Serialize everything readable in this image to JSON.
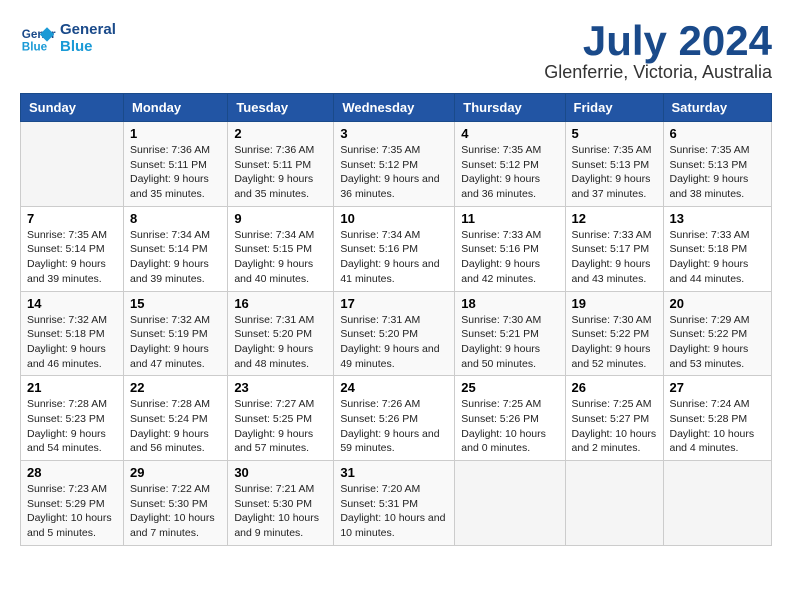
{
  "logo": {
    "line1": "General",
    "line2": "Blue"
  },
  "title": "July 2024",
  "location": "Glenferrie, Victoria, Australia",
  "headers": [
    "Sunday",
    "Monday",
    "Tuesday",
    "Wednesday",
    "Thursday",
    "Friday",
    "Saturday"
  ],
  "weeks": [
    [
      {
        "day": "",
        "sunrise": "",
        "sunset": "",
        "daylight": ""
      },
      {
        "day": "1",
        "sunrise": "Sunrise: 7:36 AM",
        "sunset": "Sunset: 5:11 PM",
        "daylight": "Daylight: 9 hours and 35 minutes."
      },
      {
        "day": "2",
        "sunrise": "Sunrise: 7:36 AM",
        "sunset": "Sunset: 5:11 PM",
        "daylight": "Daylight: 9 hours and 35 minutes."
      },
      {
        "day": "3",
        "sunrise": "Sunrise: 7:35 AM",
        "sunset": "Sunset: 5:12 PM",
        "daylight": "Daylight: 9 hours and 36 minutes."
      },
      {
        "day": "4",
        "sunrise": "Sunrise: 7:35 AM",
        "sunset": "Sunset: 5:12 PM",
        "daylight": "Daylight: 9 hours and 36 minutes."
      },
      {
        "day": "5",
        "sunrise": "Sunrise: 7:35 AM",
        "sunset": "Sunset: 5:13 PM",
        "daylight": "Daylight: 9 hours and 37 minutes."
      },
      {
        "day": "6",
        "sunrise": "Sunrise: 7:35 AM",
        "sunset": "Sunset: 5:13 PM",
        "daylight": "Daylight: 9 hours and 38 minutes."
      }
    ],
    [
      {
        "day": "7",
        "sunrise": "Sunrise: 7:35 AM",
        "sunset": "Sunset: 5:14 PM",
        "daylight": "Daylight: 9 hours and 39 minutes."
      },
      {
        "day": "8",
        "sunrise": "Sunrise: 7:34 AM",
        "sunset": "Sunset: 5:14 PM",
        "daylight": "Daylight: 9 hours and 39 minutes."
      },
      {
        "day": "9",
        "sunrise": "Sunrise: 7:34 AM",
        "sunset": "Sunset: 5:15 PM",
        "daylight": "Daylight: 9 hours and 40 minutes."
      },
      {
        "day": "10",
        "sunrise": "Sunrise: 7:34 AM",
        "sunset": "Sunset: 5:16 PM",
        "daylight": "Daylight: 9 hours and 41 minutes."
      },
      {
        "day": "11",
        "sunrise": "Sunrise: 7:33 AM",
        "sunset": "Sunset: 5:16 PM",
        "daylight": "Daylight: 9 hours and 42 minutes."
      },
      {
        "day": "12",
        "sunrise": "Sunrise: 7:33 AM",
        "sunset": "Sunset: 5:17 PM",
        "daylight": "Daylight: 9 hours and 43 minutes."
      },
      {
        "day": "13",
        "sunrise": "Sunrise: 7:33 AM",
        "sunset": "Sunset: 5:18 PM",
        "daylight": "Daylight: 9 hours and 44 minutes."
      }
    ],
    [
      {
        "day": "14",
        "sunrise": "Sunrise: 7:32 AM",
        "sunset": "Sunset: 5:18 PM",
        "daylight": "Daylight: 9 hours and 46 minutes."
      },
      {
        "day": "15",
        "sunrise": "Sunrise: 7:32 AM",
        "sunset": "Sunset: 5:19 PM",
        "daylight": "Daylight: 9 hours and 47 minutes."
      },
      {
        "day": "16",
        "sunrise": "Sunrise: 7:31 AM",
        "sunset": "Sunset: 5:20 PM",
        "daylight": "Daylight: 9 hours and 48 minutes."
      },
      {
        "day": "17",
        "sunrise": "Sunrise: 7:31 AM",
        "sunset": "Sunset: 5:20 PM",
        "daylight": "Daylight: 9 hours and 49 minutes."
      },
      {
        "day": "18",
        "sunrise": "Sunrise: 7:30 AM",
        "sunset": "Sunset: 5:21 PM",
        "daylight": "Daylight: 9 hours and 50 minutes."
      },
      {
        "day": "19",
        "sunrise": "Sunrise: 7:30 AM",
        "sunset": "Sunset: 5:22 PM",
        "daylight": "Daylight: 9 hours and 52 minutes."
      },
      {
        "day": "20",
        "sunrise": "Sunrise: 7:29 AM",
        "sunset": "Sunset: 5:22 PM",
        "daylight": "Daylight: 9 hours and 53 minutes."
      }
    ],
    [
      {
        "day": "21",
        "sunrise": "Sunrise: 7:28 AM",
        "sunset": "Sunset: 5:23 PM",
        "daylight": "Daylight: 9 hours and 54 minutes."
      },
      {
        "day": "22",
        "sunrise": "Sunrise: 7:28 AM",
        "sunset": "Sunset: 5:24 PM",
        "daylight": "Daylight: 9 hours and 56 minutes."
      },
      {
        "day": "23",
        "sunrise": "Sunrise: 7:27 AM",
        "sunset": "Sunset: 5:25 PM",
        "daylight": "Daylight: 9 hours and 57 minutes."
      },
      {
        "day": "24",
        "sunrise": "Sunrise: 7:26 AM",
        "sunset": "Sunset: 5:26 PM",
        "daylight": "Daylight: 9 hours and 59 minutes."
      },
      {
        "day": "25",
        "sunrise": "Sunrise: 7:25 AM",
        "sunset": "Sunset: 5:26 PM",
        "daylight": "Daylight: 10 hours and 0 minutes."
      },
      {
        "day": "26",
        "sunrise": "Sunrise: 7:25 AM",
        "sunset": "Sunset: 5:27 PM",
        "daylight": "Daylight: 10 hours and 2 minutes."
      },
      {
        "day": "27",
        "sunrise": "Sunrise: 7:24 AM",
        "sunset": "Sunset: 5:28 PM",
        "daylight": "Daylight: 10 hours and 4 minutes."
      }
    ],
    [
      {
        "day": "28",
        "sunrise": "Sunrise: 7:23 AM",
        "sunset": "Sunset: 5:29 PM",
        "daylight": "Daylight: 10 hours and 5 minutes."
      },
      {
        "day": "29",
        "sunrise": "Sunrise: 7:22 AM",
        "sunset": "Sunset: 5:30 PM",
        "daylight": "Daylight: 10 hours and 7 minutes."
      },
      {
        "day": "30",
        "sunrise": "Sunrise: 7:21 AM",
        "sunset": "Sunset: 5:30 PM",
        "daylight": "Daylight: 10 hours and 9 minutes."
      },
      {
        "day": "31",
        "sunrise": "Sunrise: 7:20 AM",
        "sunset": "Sunset: 5:31 PM",
        "daylight": "Daylight: 10 hours and 10 minutes."
      },
      {
        "day": "",
        "sunrise": "",
        "sunset": "",
        "daylight": ""
      },
      {
        "day": "",
        "sunrise": "",
        "sunset": "",
        "daylight": ""
      },
      {
        "day": "",
        "sunrise": "",
        "sunset": "",
        "daylight": ""
      }
    ]
  ]
}
